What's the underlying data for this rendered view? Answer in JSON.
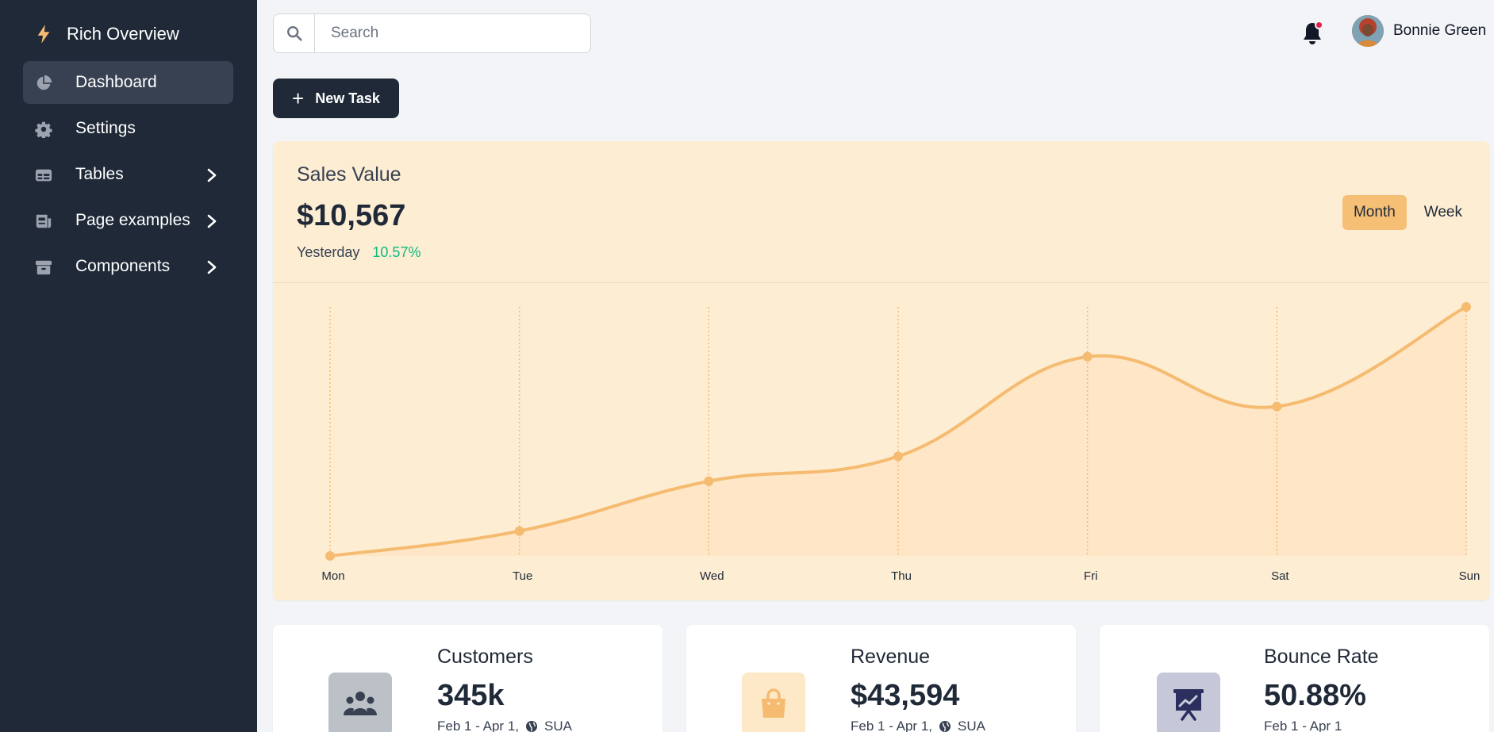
{
  "sidebar": {
    "brand": "Rich Overview",
    "items": [
      {
        "label": "Dashboard",
        "icon": "pie-chart-icon",
        "active": true
      },
      {
        "label": "Settings",
        "icon": "gear-icon"
      },
      {
        "label": "Tables",
        "icon": "table-icon",
        "has_children": true
      },
      {
        "label": "Page examples",
        "icon": "newspaper-icon",
        "has_children": true
      },
      {
        "label": "Components",
        "icon": "archive-icon",
        "has_children": true
      }
    ]
  },
  "header": {
    "search_placeholder": "Search",
    "user_name": "Bonnie Green",
    "notifications_unread": true
  },
  "actions": {
    "new_task_label": "New Task"
  },
  "sales": {
    "title": "Sales Value",
    "value": "$10,567",
    "period_label": "Yesterday",
    "change": "10.57%",
    "toggle": [
      "Month",
      "Week"
    ],
    "toggle_selected": "Month"
  },
  "chart_data": {
    "type": "area",
    "categories": [
      "Mon",
      "Tue",
      "Wed",
      "Thu",
      "Fri",
      "Sat",
      "Sun"
    ],
    "series": [
      {
        "values": [
          0,
          10,
          30,
          40,
          80,
          60,
          100
        ]
      }
    ],
    "ylim": [
      0,
      100
    ],
    "grid": "vertical dotted",
    "color": "#f5bb70"
  },
  "stats": [
    {
      "title": "Customers",
      "value": "345k",
      "range": "Feb 1 - Apr 1,",
      "region": "SUA",
      "icon": "users-icon",
      "icon_bg": "#bcc1c8",
      "icon_color": "#374151"
    },
    {
      "title": "Revenue",
      "value": "$43,594",
      "range": "Feb 1 - Apr 1,",
      "region": "SUA",
      "icon": "shopping-bag-icon",
      "icon_bg": "#fde9c8",
      "icon_color": "#f5bb70"
    },
    {
      "title": "Bounce Rate",
      "value": "50.88%",
      "range": "Feb 1 - Apr 1",
      "icon": "presentation-chart-icon",
      "icon_bg": "#c6c8d9",
      "icon_color": "#2b2f5e"
    }
  ]
}
